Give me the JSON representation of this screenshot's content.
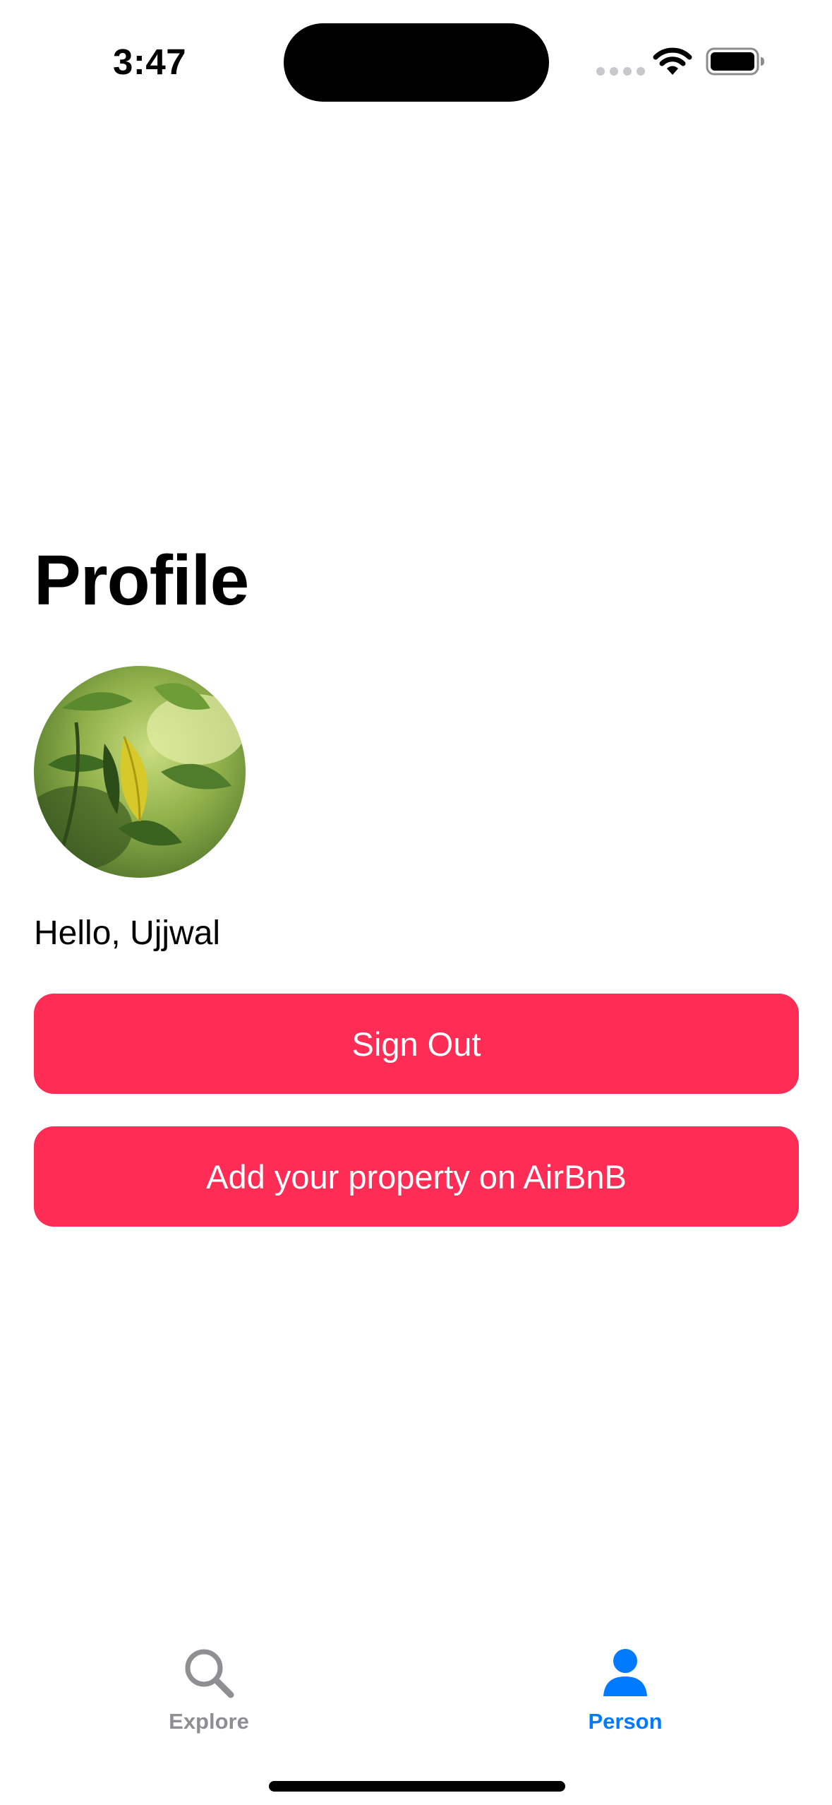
{
  "status_bar": {
    "time": "3:47",
    "icons": [
      "cellular-signal-icon",
      "wifi-icon",
      "battery-icon"
    ]
  },
  "profile": {
    "title": "Profile",
    "avatar": "leaf-photo",
    "greeting": "Hello, Ujjwal"
  },
  "buttons": {
    "sign_out_label": "Sign Out",
    "add_property_label": "Add your property on AirBnB",
    "color": "#ff2d55"
  },
  "tab_bar": {
    "items": [
      {
        "label": "Explore",
        "icon": "search-icon",
        "selected": false,
        "color": "#8e8e93"
      },
      {
        "label": "Person",
        "icon": "person-icon",
        "selected": true,
        "color": "#007aff"
      }
    ]
  }
}
